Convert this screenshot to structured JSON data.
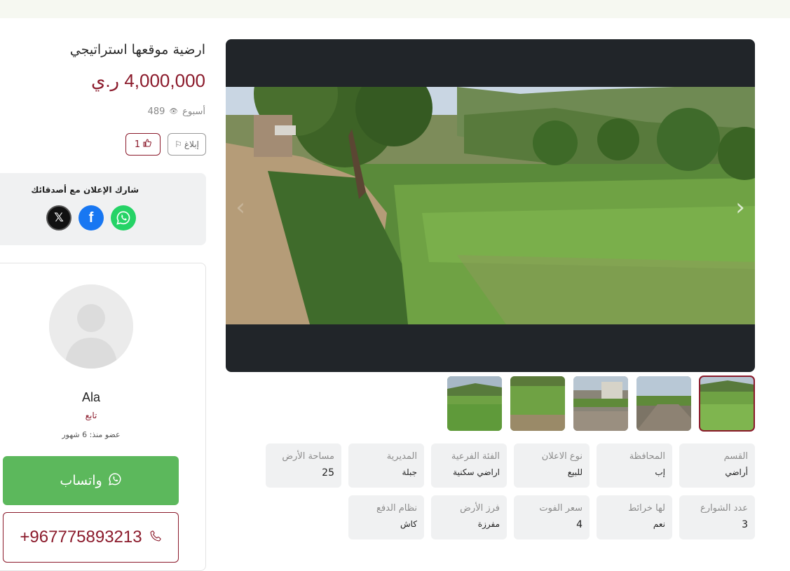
{
  "listing": {
    "title": "ارضية موقعها استراتيجي",
    "price": "4,000,000 ر.ي",
    "posted": "أسبوع",
    "views": "489",
    "likes": "1",
    "report_label": "إبلاغ"
  },
  "share": {
    "title": "شارك الإعلان مع أصدقائك",
    "networks": [
      "x-icon",
      "facebook-icon",
      "whatsapp-icon"
    ]
  },
  "seller": {
    "name": "Ala",
    "follow_label": "تابع",
    "member_since": "عضو منذ: 6 شهور",
    "whatsapp_label": "واتساب",
    "phone": "+967775893213"
  },
  "gallery": {
    "thumbnail_count": 5,
    "active_thumbnail": 1
  },
  "specs": [
    {
      "label": "القسم",
      "value": "أراضي"
    },
    {
      "label": "المحافظة",
      "value": "إب"
    },
    {
      "label": "نوع الاعلان",
      "value": "للبيع"
    },
    {
      "label": "الفئة الفرعية",
      "value": "اراضي سكنية"
    },
    {
      "label": "المديرية",
      "value": "جبلة"
    },
    {
      "label": "مساحة الأرض",
      "value": "25"
    },
    {
      "label": "عدد الشوارع",
      "value": "3"
    },
    {
      "label": "لها خرائط",
      "value": "نعم"
    },
    {
      "label": "سعر الفوت",
      "value": "4"
    },
    {
      "label": "فرز الأرض",
      "value": "مفرزة"
    },
    {
      "label": "نظام الدفع",
      "value": "كاش"
    }
  ],
  "colors": {
    "brand": "#8b1a2b",
    "whatsapp_button": "#5cb85c",
    "gallery_bg": "#212529",
    "card_bg": "#f0f1f2"
  }
}
